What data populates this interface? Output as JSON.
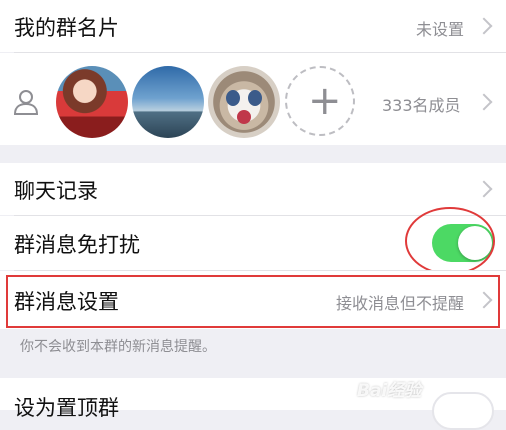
{
  "group_card": {
    "label": "我的群名片",
    "value": "未设置"
  },
  "members": {
    "count_label": "333名成员",
    "add_symbol": "+"
  },
  "chat_history": {
    "label": "聊天记录"
  },
  "mute": {
    "label": "群消息免打扰",
    "enabled": true
  },
  "message_settings": {
    "label": "群消息设置",
    "value": "接收消息但不提醒"
  },
  "note": "你不会收到本群的新消息提醒。",
  "pin": {
    "label": "设为置顶群",
    "enabled": false
  },
  "watermark": "Bai经验",
  "colors": {
    "toggle_on": "#4cd964",
    "annotation_red": "#e03a3a",
    "background": "#efeff4"
  }
}
